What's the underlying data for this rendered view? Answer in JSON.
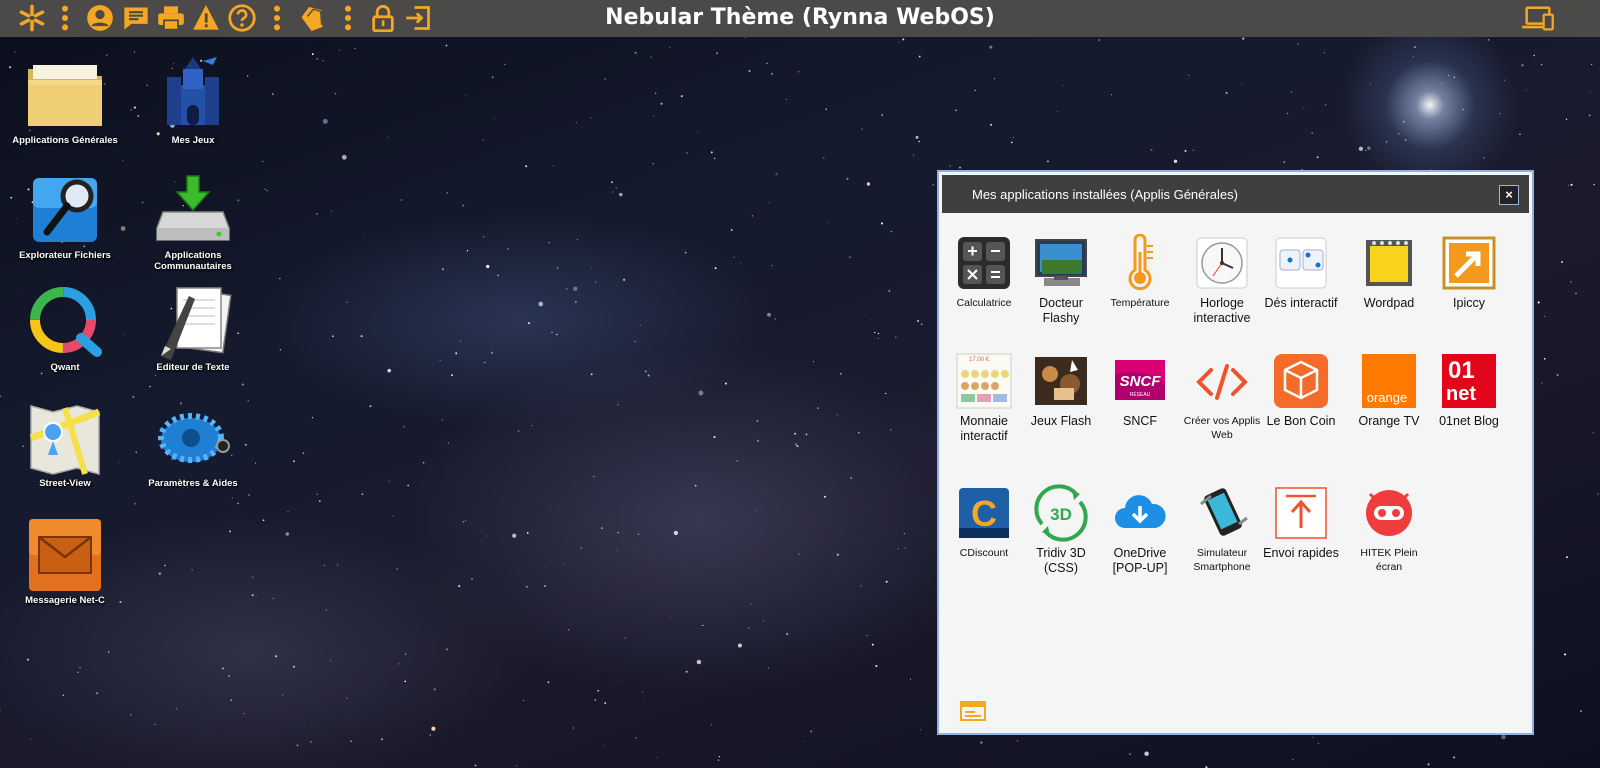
{
  "topbar": {
    "title": "Nebular Thème (Rynna WebOS)",
    "accent": "#f5a623",
    "background": "#4b4a48",
    "left_icons": [
      "asterisk-menu-icon",
      "vertical-dots-icon",
      "user-icon",
      "notes-icon",
      "print-icon",
      "warning-icon",
      "help-icon",
      "vertical-dots-icon",
      "tags-icon",
      "vertical-dots-icon",
      "lock-icon",
      "logout-icon"
    ],
    "right_icons": [
      "devices-icon"
    ]
  },
  "desktop": {
    "icons": [
      {
        "label": "Applications Générales",
        "icon": "folder-icon"
      },
      {
        "label": "Mes Jeux",
        "icon": "castle-icon"
      },
      {
        "label": "Explorateur Fichiers",
        "icon": "magnifier-icon"
      },
      {
        "label": "Applications Communautaires",
        "icon": "download-drive-icon"
      },
      {
        "label": "Qwant",
        "icon": "qwant-icon"
      },
      {
        "label": "Editeur de Texte",
        "icon": "notepad-pen-icon"
      },
      {
        "label": "Street-View",
        "icon": "map-icon"
      },
      {
        "label": "Paramètres & Aides",
        "icon": "gear-icon"
      },
      {
        "label": "Messagerie Net-C",
        "icon": "envelope-icon"
      }
    ]
  },
  "window": {
    "title": "Mes applications installées (Applis Générales)",
    "close": "×",
    "apps": [
      {
        "name": "Calculatrice",
        "icon": "calculator-icon"
      },
      {
        "name": "Docteur Flashy",
        "icon": "monitor-icon"
      },
      {
        "name": "Température",
        "icon": "thermometer-icon"
      },
      {
        "name": "Horloge interactive",
        "icon": "clock-icon"
      },
      {
        "name": "Dés interactif",
        "icon": "dice-icon"
      },
      {
        "name": "Wordpad",
        "icon": "notepad-icon"
      },
      {
        "name": "Ipiccy",
        "icon": "ipiccy-icon"
      },
      {
        "name": "Monnaie interactif",
        "icon": "money-icon"
      },
      {
        "name": "Jeux Flash",
        "icon": "flash-games-icon"
      },
      {
        "name": "SNCF",
        "icon": "sncf-icon"
      },
      {
        "name": "Créer vos Applis Web",
        "icon": "code-icon"
      },
      {
        "name": "Le Bon Coin",
        "icon": "box-icon"
      },
      {
        "name": "Orange TV",
        "icon": "orange-icon"
      },
      {
        "name": "01net Blog",
        "icon": "01net-icon"
      },
      {
        "name": "CDiscount",
        "icon": "cdiscount-icon"
      },
      {
        "name": "Tridiv 3D (CSS)",
        "icon": "3d-icon"
      },
      {
        "name": "OneDrive [POP-UP]",
        "icon": "cloud-download-icon"
      },
      {
        "name": "Simulateur Smartphone",
        "icon": "smartphone-icon"
      },
      {
        "name": "Envoi rapides",
        "icon": "upload-icon"
      },
      {
        "name": "HITEK Plein écran",
        "icon": "hitek-icon"
      }
    ],
    "icon_labels": {
      "sncf": "SNCF",
      "sncf_sub": "RÉSEAU",
      "orange": "orange",
      "net01_top": "01",
      "net01_bottom": "net",
      "tridiv": "3D",
      "money_price": "17,00 €"
    }
  }
}
